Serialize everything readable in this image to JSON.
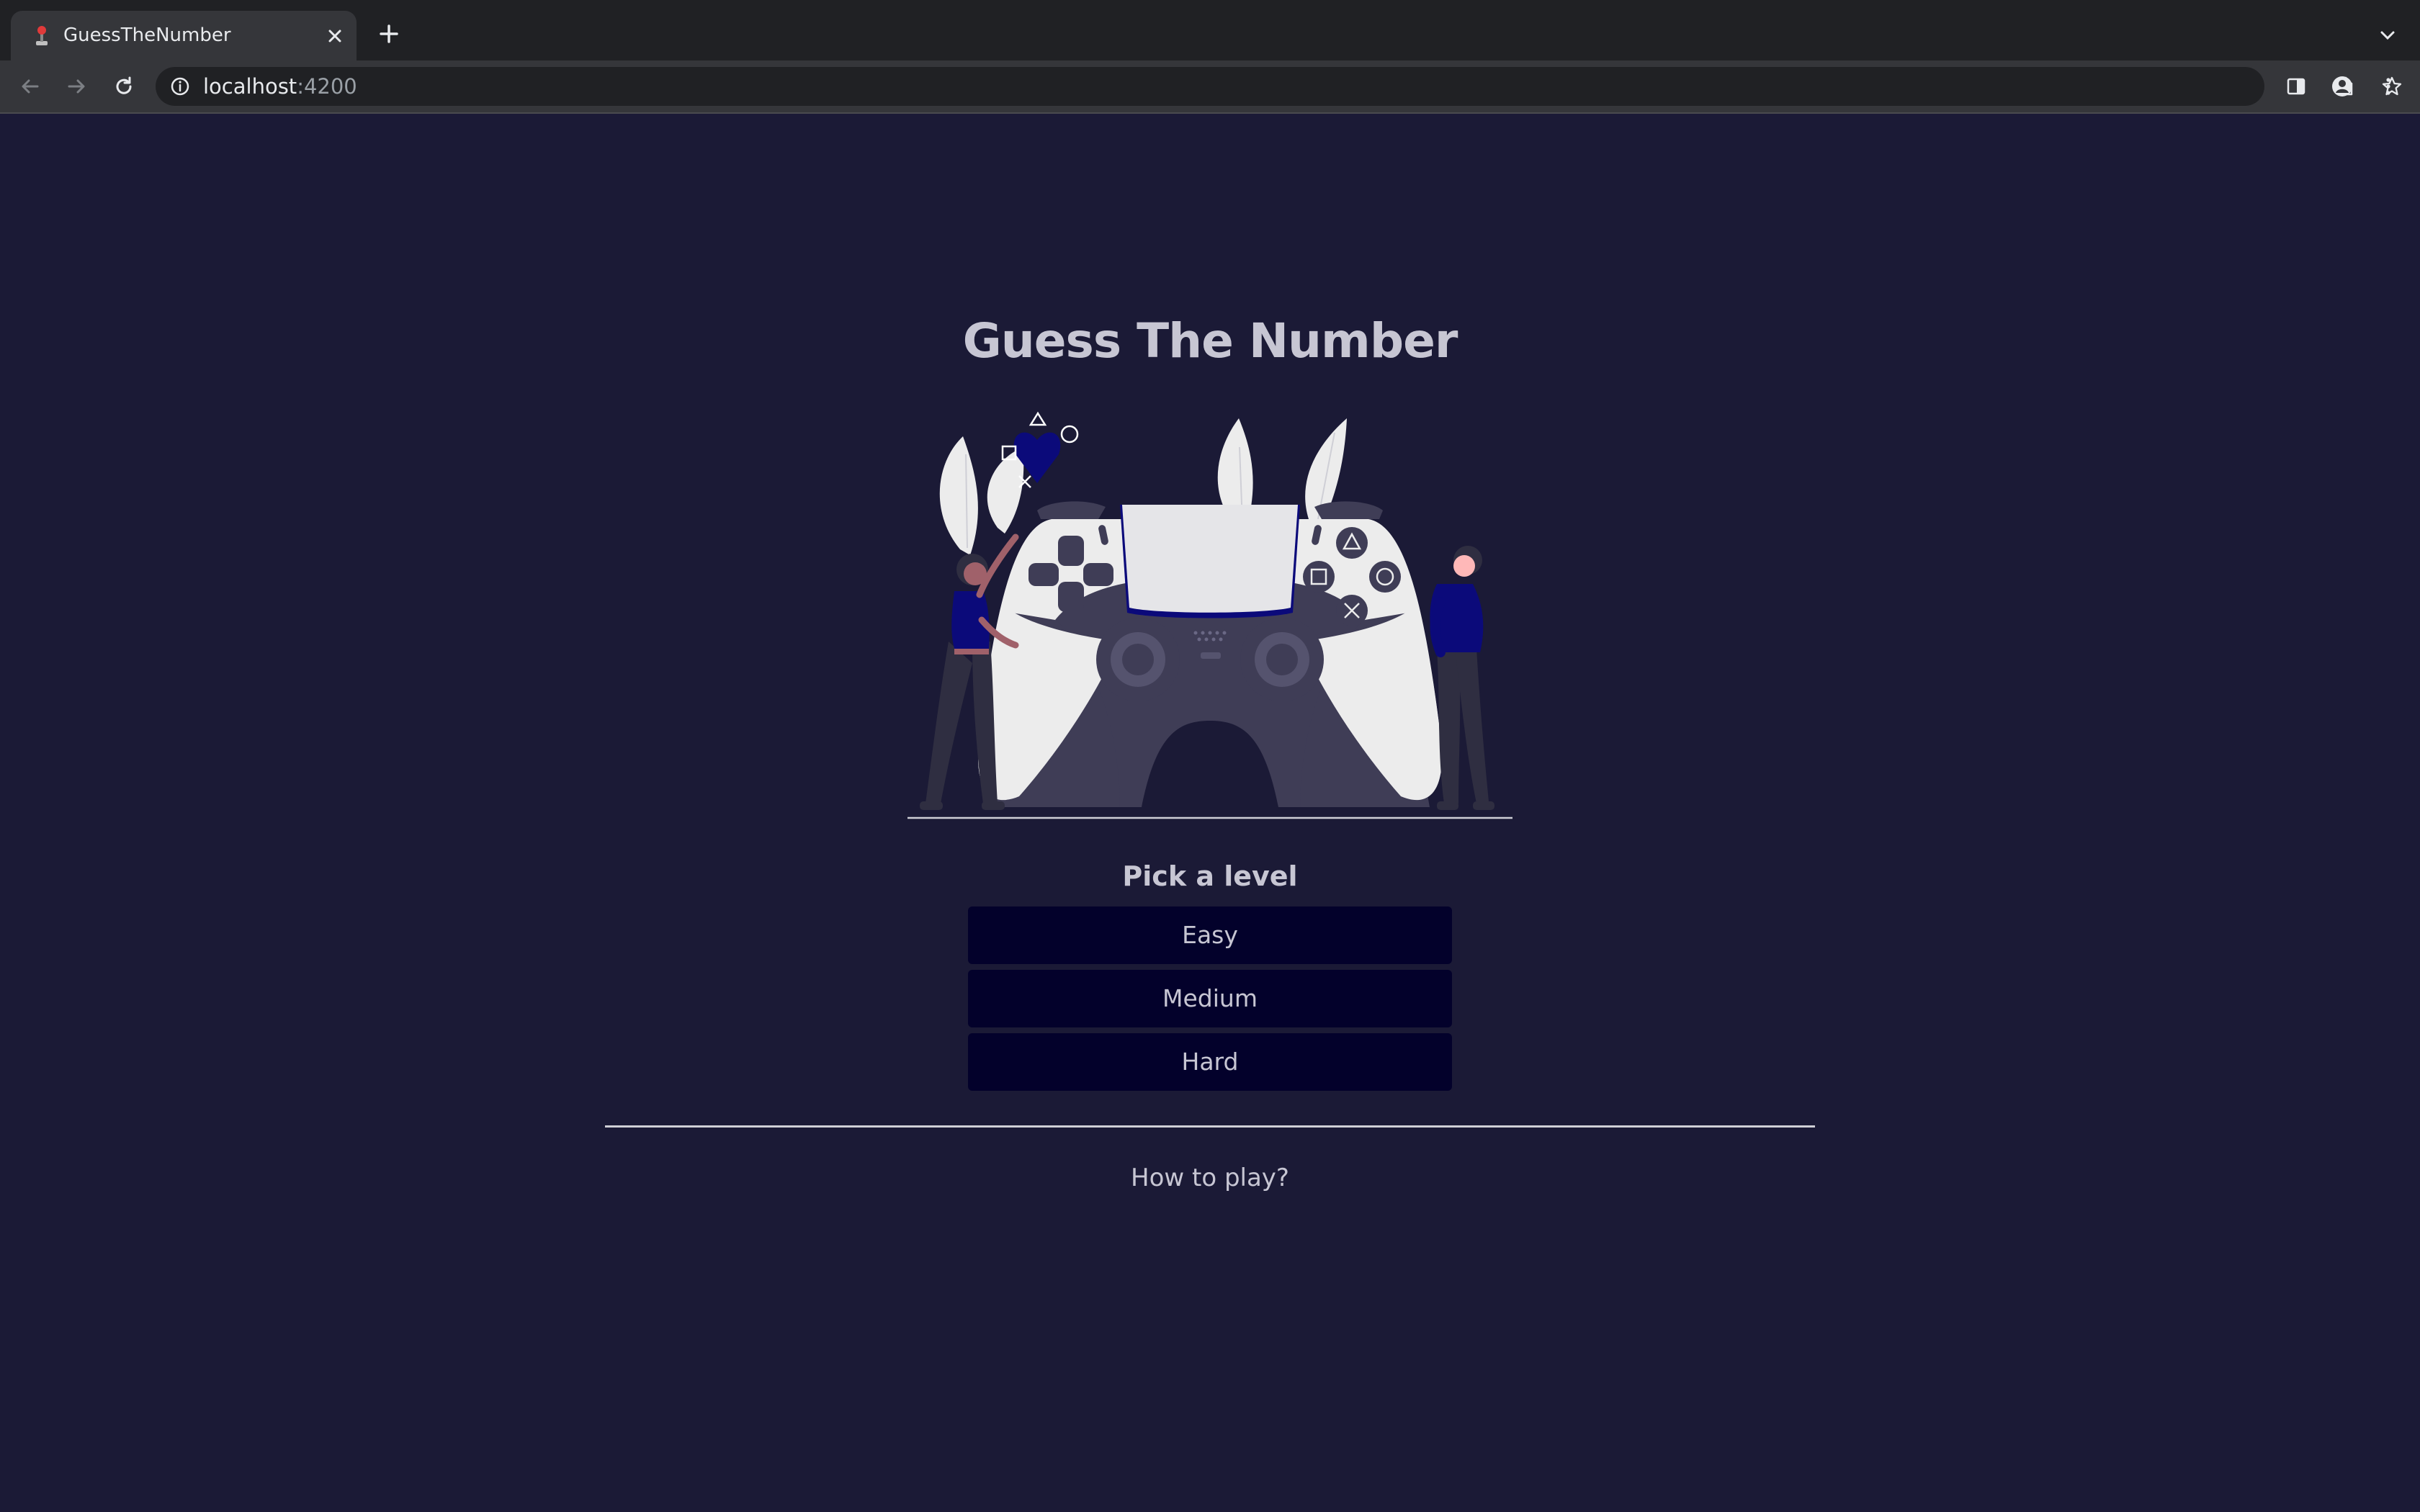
{
  "browser": {
    "tab_title": "GuessTheNumber",
    "url_host": "localhost",
    "url_port": ":4200"
  },
  "page": {
    "title": "Guess The Number",
    "level_heading": "Pick a level",
    "levels": [
      "Easy",
      "Medium",
      "Hard"
    ],
    "how_to_play": "How to play?"
  },
  "colors": {
    "background": "#1b1a36",
    "button": "#03012b",
    "text": "#c7c6d3",
    "accent": "#0b0a7a"
  },
  "icons": {
    "hero": "game-controller-illustration"
  }
}
